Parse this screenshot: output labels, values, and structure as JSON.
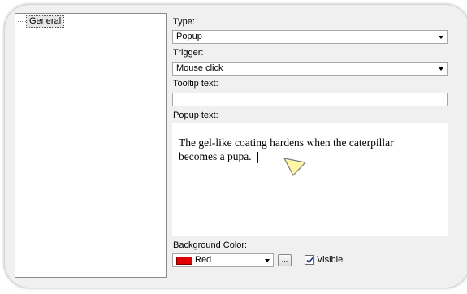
{
  "tree": {
    "items": [
      "General"
    ]
  },
  "form": {
    "type_label": "Type:",
    "type_value": "Popup",
    "trigger_label": "Trigger:",
    "trigger_value": "Mouse click",
    "tooltip_label": "Tooltip text:",
    "tooltip_value": "",
    "popup_label": "Popup text:",
    "popup_text": "The gel-like coating hardens when the caterpillar becomes a pupa.",
    "bg_label": "Background Color:",
    "bg_value": "Red",
    "bg_color": "#e00000",
    "more_label": "...",
    "visible_label": "Visible",
    "visible_checked": true
  },
  "icons": [
    "chevron-down-icon",
    "checkmark-icon",
    "pointer-callout-icon"
  ]
}
